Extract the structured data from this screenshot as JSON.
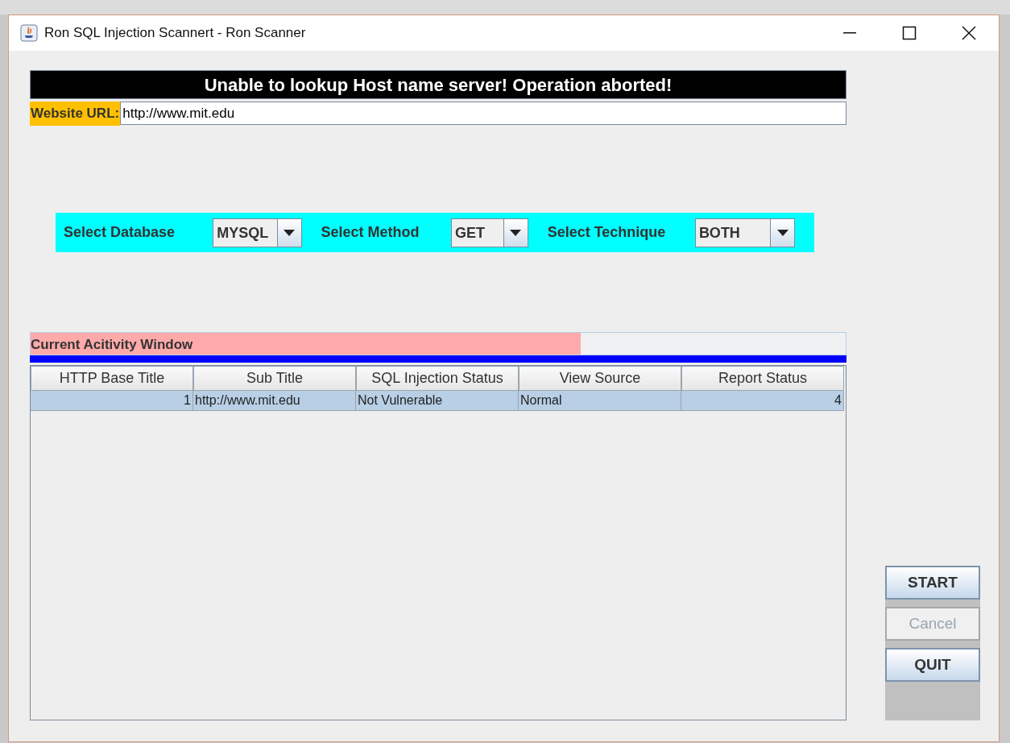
{
  "window": {
    "title": "Ron SQL Injection Scannert - Ron Scanner"
  },
  "message": "Unable to lookup Host name server! Operation aborted!",
  "url_field": {
    "label": "Website URL:",
    "value": "http://www.mit.edu"
  },
  "selectors": [
    {
      "label": "Select Database",
      "value": "MYSQL"
    },
    {
      "label": "Select Method",
      "value": "GET"
    },
    {
      "label": "Select Technique",
      "value": "BOTH"
    }
  ],
  "activity": {
    "label": "Current Acitivity Window",
    "level": 0.675
  },
  "table": {
    "columns": [
      {
        "label": "HTTP Base Title",
        "numeric": true
      },
      {
        "label": "Sub Title",
        "numeric": false
      },
      {
        "label": "SQL Injection Status",
        "numeric": false
      },
      {
        "label": "View Source",
        "numeric": false
      },
      {
        "label": "Report Status",
        "numeric": true
      }
    ],
    "rows": [
      {
        "selected": true,
        "cells": [
          "1",
          "http://www.mit.edu",
          "Not Vulnerable",
          "Normal",
          "4"
        ]
      }
    ]
  },
  "buttons": [
    {
      "label": "START",
      "disabled": false
    },
    {
      "label": "Cancel",
      "disabled": true
    },
    {
      "label": "QUIT",
      "disabled": false
    }
  ]
}
